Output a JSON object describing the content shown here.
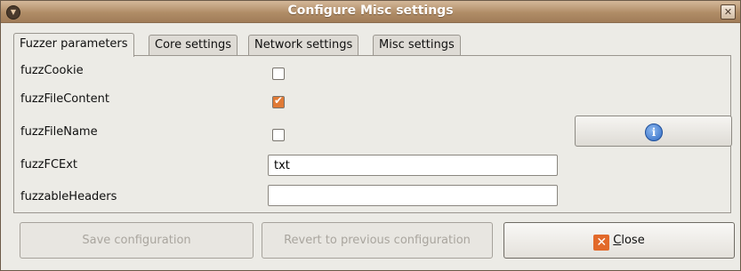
{
  "window": {
    "title": "Configure Misc settings",
    "close_glyph": "✕"
  },
  "tabs": [
    {
      "label": "Fuzzer parameters",
      "active": true
    },
    {
      "label": "Core settings",
      "active": false
    },
    {
      "label": "Network settings",
      "active": false
    },
    {
      "label": "Misc settings",
      "active": false
    }
  ],
  "fields": {
    "fuzzCookie": {
      "label": "fuzzCookie",
      "checked": false
    },
    "fuzzFileContent": {
      "label": "fuzzFileContent",
      "checked": true
    },
    "fuzzFileName": {
      "label": "fuzzFileName",
      "checked": false
    },
    "fuzzFCExt": {
      "label": "fuzzFCExt",
      "value": "txt"
    },
    "fuzzableHeaders": {
      "label": "fuzzableHeaders",
      "value": ""
    }
  },
  "info_button": {
    "icon": "info-icon",
    "glyph": "i"
  },
  "buttons": {
    "save": {
      "label": "Save configuration",
      "enabled": false
    },
    "revert": {
      "label": "Revert to previous configuration",
      "enabled": false
    },
    "close": {
      "label_first": "C",
      "label_rest": "lose",
      "icon": "close-icon",
      "enabled": true
    }
  },
  "colors": {
    "accent": "#e07a36",
    "titlebar": "#b08d67"
  }
}
